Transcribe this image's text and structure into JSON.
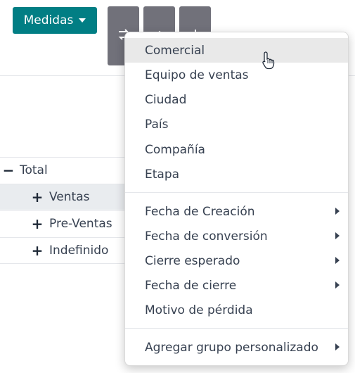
{
  "toolbar": {
    "measures_label": "Medidas",
    "tool_icons": [
      "flip-axis-icon",
      "expand-icon",
      "download-icon"
    ]
  },
  "pivot": {
    "rows": [
      {
        "symbol": "−",
        "label": "Total"
      },
      {
        "symbol": "+",
        "label": "Ventas"
      },
      {
        "symbol": "+",
        "label": "Pre-Ventas"
      },
      {
        "symbol": "+",
        "label": "Indefinido"
      }
    ]
  },
  "group_by_menu": {
    "fields": [
      "Comercial",
      "Equipo de ventas",
      "Ciudad",
      "País",
      "Compañía",
      "Etapa"
    ],
    "date_fields": [
      "Fecha de Creación",
      "Fecha de conversión",
      "Cierre esperado",
      "Fecha de cierre"
    ],
    "other_field": "Motivo de pérdida",
    "custom_group": "Agregar grupo personalizado"
  },
  "colors": {
    "primary": "#017e84",
    "tool_button": "#71717a",
    "row_highlight": "#e9ecef",
    "menu_hover": "#e9e9e9"
  }
}
